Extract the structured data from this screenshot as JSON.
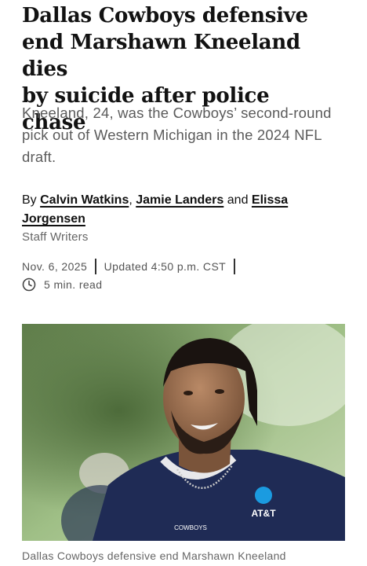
{
  "article": {
    "headline_line0": "Dallas Cowboys defensive",
    "headline_line1": "end Marshawn Kneeland dies",
    "headline_line2": "by suicide after police",
    "headline_line3": "chase",
    "dek": "Kneeland, 24, was the Cowboys’ second-round pick out of Western Michigan in the 2024 NFL draft.",
    "byline": {
      "prefix": "By",
      "author1": "Calvin Watkins",
      "comma": ",",
      "author2": "Jamie Landers",
      "conj": "and",
      "author3": "Elissa Jorgensen",
      "role": "Staff Writers"
    },
    "date": "Nov. 6, 2025",
    "updated": "Updated 4:50 p.m. CST",
    "read_time": "5 min. read",
    "photo": {
      "jersey_sponsor": "AT&T",
      "jersey_text": "COWBOYS"
    },
    "caption": "Dallas Cowboys defensive end Marshawn Kneeland"
  },
  "colors": {
    "headline": "#121212",
    "dek": "#5b5b5b",
    "jersey": "#1f2b55"
  }
}
